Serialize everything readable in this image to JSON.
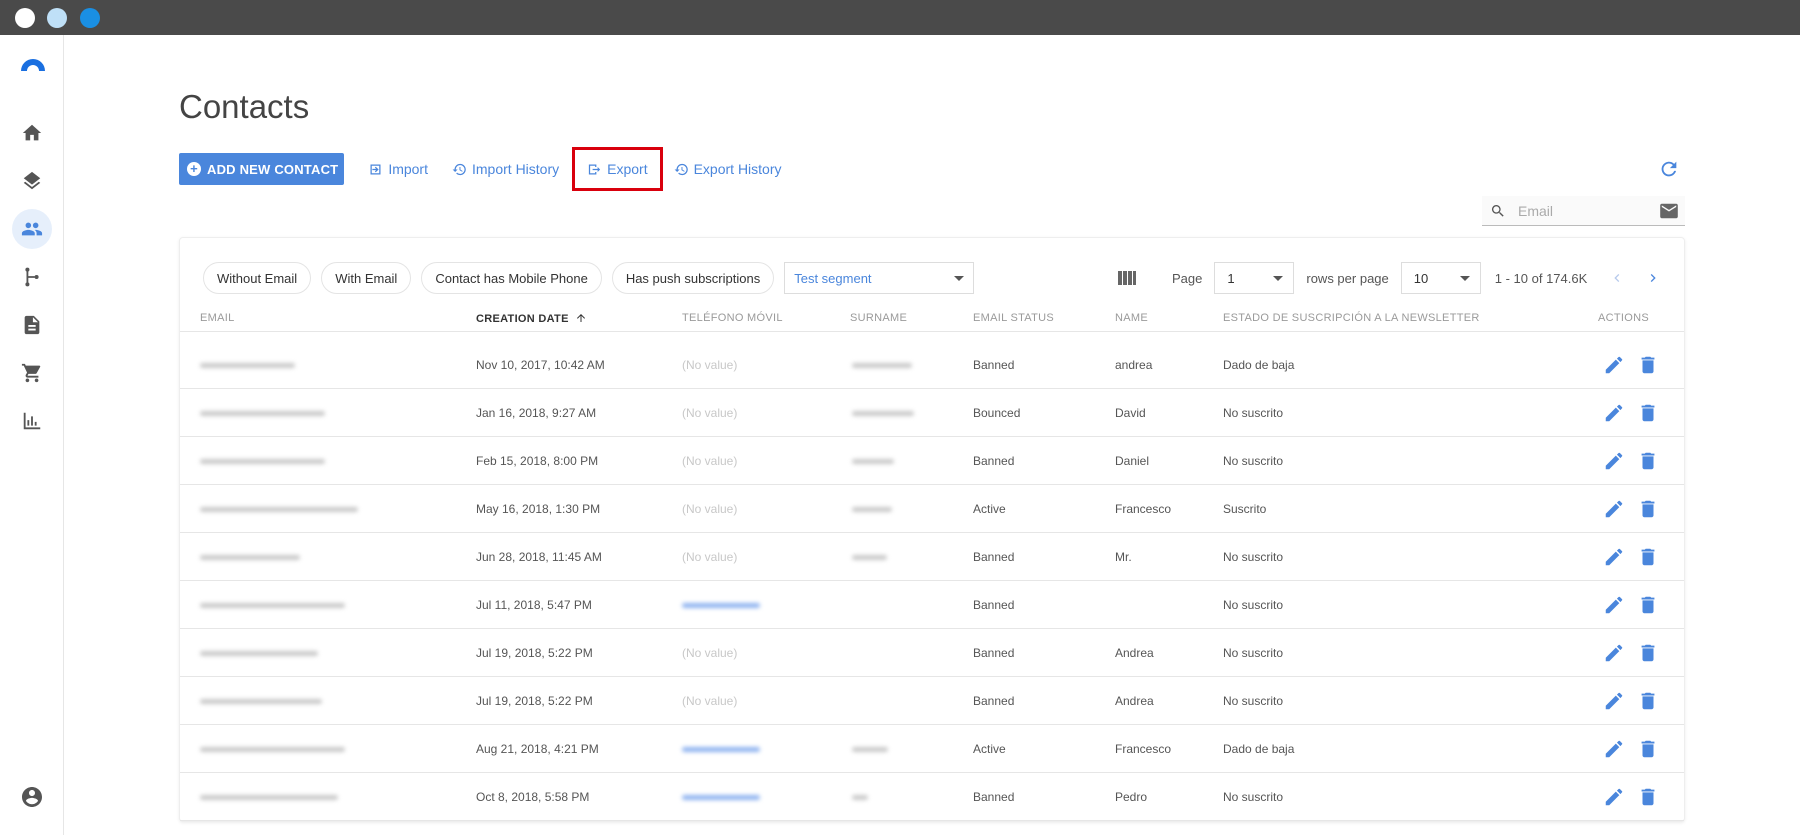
{
  "page": {
    "title": "Contacts"
  },
  "toolbar": {
    "add_label": "ADD NEW CONTACT",
    "import_label": "Import",
    "import_history_label": "Import History",
    "export_label": "Export",
    "export_history_label": "Export History"
  },
  "search": {
    "placeholder": "Email"
  },
  "filters": {
    "chips": [
      "Without Email",
      "With Email",
      "Contact has Mobile Phone",
      "Has push subscriptions"
    ],
    "segment": "Test segment"
  },
  "pager": {
    "page_label": "Page",
    "page_value": "1",
    "rows_label": "rows per page",
    "rows_value": "10",
    "range": "1 - 10 of 174.6K"
  },
  "columns": {
    "email": "EMAIL",
    "creation_date": "CREATION DATE",
    "mobile": "TELÉFONO MÓVIL",
    "surname": "SURNAME",
    "email_status": "EMAIL STATUS",
    "name": "NAME",
    "newsletter": "ESTADO DE SUSCRIPCIÓN A LA NEWSLETTER",
    "actions": "ACTIONS"
  },
  "rows": [
    {
      "date": "Nov 10, 2017, 10:42 AM",
      "mobile": "(No value)",
      "status": "Banned",
      "name": "andrea",
      "newsletter": "Dado de baja"
    },
    {
      "date": "Jan 16, 2018, 9:27 AM",
      "mobile": "(No value)",
      "status": "Bounced",
      "name": "David",
      "newsletter": "No suscrito"
    },
    {
      "date": "Feb 15, 2018, 8:00 PM",
      "mobile": "(No value)",
      "status": "Banned",
      "name": "Daniel",
      "newsletter": "No suscrito"
    },
    {
      "date": "May 16, 2018, 1:30 PM",
      "mobile": "(No value)",
      "status": "Active",
      "name": "Francesco",
      "newsletter": "Suscrito"
    },
    {
      "date": "Jun 28, 2018, 11:45 AM",
      "mobile": "(No value)",
      "status": "Banned",
      "name": "Mr.",
      "newsletter": "No suscrito"
    },
    {
      "date": "Jul 11, 2018, 5:47 PM",
      "mobile": "",
      "status": "Banned",
      "name": "",
      "newsletter": "No suscrito"
    },
    {
      "date": "Jul 19, 2018, 5:22 PM",
      "mobile": "(No value)",
      "status": "Banned",
      "name": "Andrea",
      "newsletter": "No suscrito"
    },
    {
      "date": "Jul 19, 2018, 5:22 PM",
      "mobile": "(No value)",
      "status": "Banned",
      "name": "Andrea",
      "newsletter": "No suscrito"
    },
    {
      "date": "Aug 21, 2018, 4:21 PM",
      "mobile": "",
      "status": "Active",
      "name": "Francesco",
      "newsletter": "Dado de baja"
    },
    {
      "date": "Oct 8, 2018, 5:58 PM",
      "mobile": "",
      "status": "Banned",
      "name": "Pedro",
      "newsletter": "No suscrito"
    }
  ],
  "colors": {
    "accent": "#4a86dc",
    "highlight": "#d9000d",
    "titlebar": "#4a4a4a"
  },
  "icons": [
    "home-icon",
    "layers-icon",
    "people-icon",
    "flow-icon",
    "document-icon",
    "cart-icon",
    "chart-icon",
    "user-icon",
    "refresh-icon",
    "search-icon",
    "mail-icon",
    "columns-icon",
    "edit-icon",
    "delete-icon"
  ]
}
